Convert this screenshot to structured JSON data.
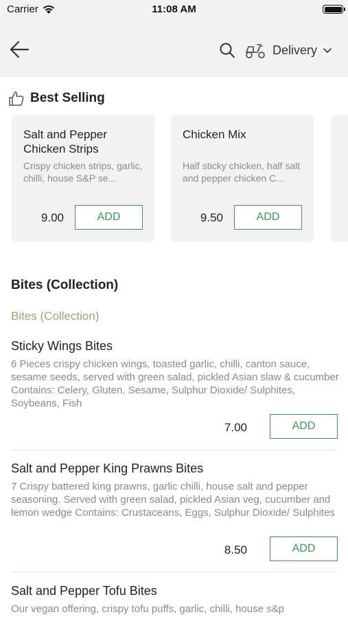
{
  "status_bar": {
    "carrier": "Carrier",
    "time": "11:08 AM"
  },
  "nav": {
    "delivery_label": "Delivery"
  },
  "best_selling": {
    "title": "Best Selling",
    "items": [
      {
        "name": "Salt and Pepper Chicken Strips",
        "desc": "Crispy chicken strips, garlic, chilli, house S&P se...",
        "price": "9.00",
        "add_label": "ADD"
      },
      {
        "name": "Chicken Mix",
        "desc": "Half sticky chicken, half salt and pepper chicken C...",
        "price": "9.50",
        "add_label": "ADD"
      }
    ]
  },
  "section": {
    "title": "Bites (Collection)",
    "subtitle": "Bites (Collection)"
  },
  "menu_items": [
    {
      "name": "Sticky Wings Bites",
      "desc": "6 Pieces crispy chicken wings, toasted garlic, chilli, canton sauce, sesame seeds, served with green salad, pickled Asian slaw & cucumber Contains: Celery, Gluten, Sesame, Sulphur Dioxide/ Sulphites, Soybeans, Fish",
      "price": "7.00",
      "add_label": "ADD"
    },
    {
      "name": "Salt and Pepper King Prawns Bites",
      "desc": "7 Crispy battered king prawns, garlic chilli, house salt and pepper seasoning. Served with green salad, pickled Asian veg, cucumber and lemon wedge Contains: Crustaceans, Eggs, Sulphur Dioxide/ Sulphites",
      "price": "8.50",
      "add_label": "ADD"
    },
    {
      "name": "Salt and Pepper Tofu Bites",
      "desc": "Our vegan offering, crispy tofu puffs, garlic, chilli, house s&p"
    }
  ],
  "colors": {
    "accent_green": "#3a9a55",
    "subtitle_gold": "#a99e71",
    "panel_grey": "#f3f3f3"
  }
}
